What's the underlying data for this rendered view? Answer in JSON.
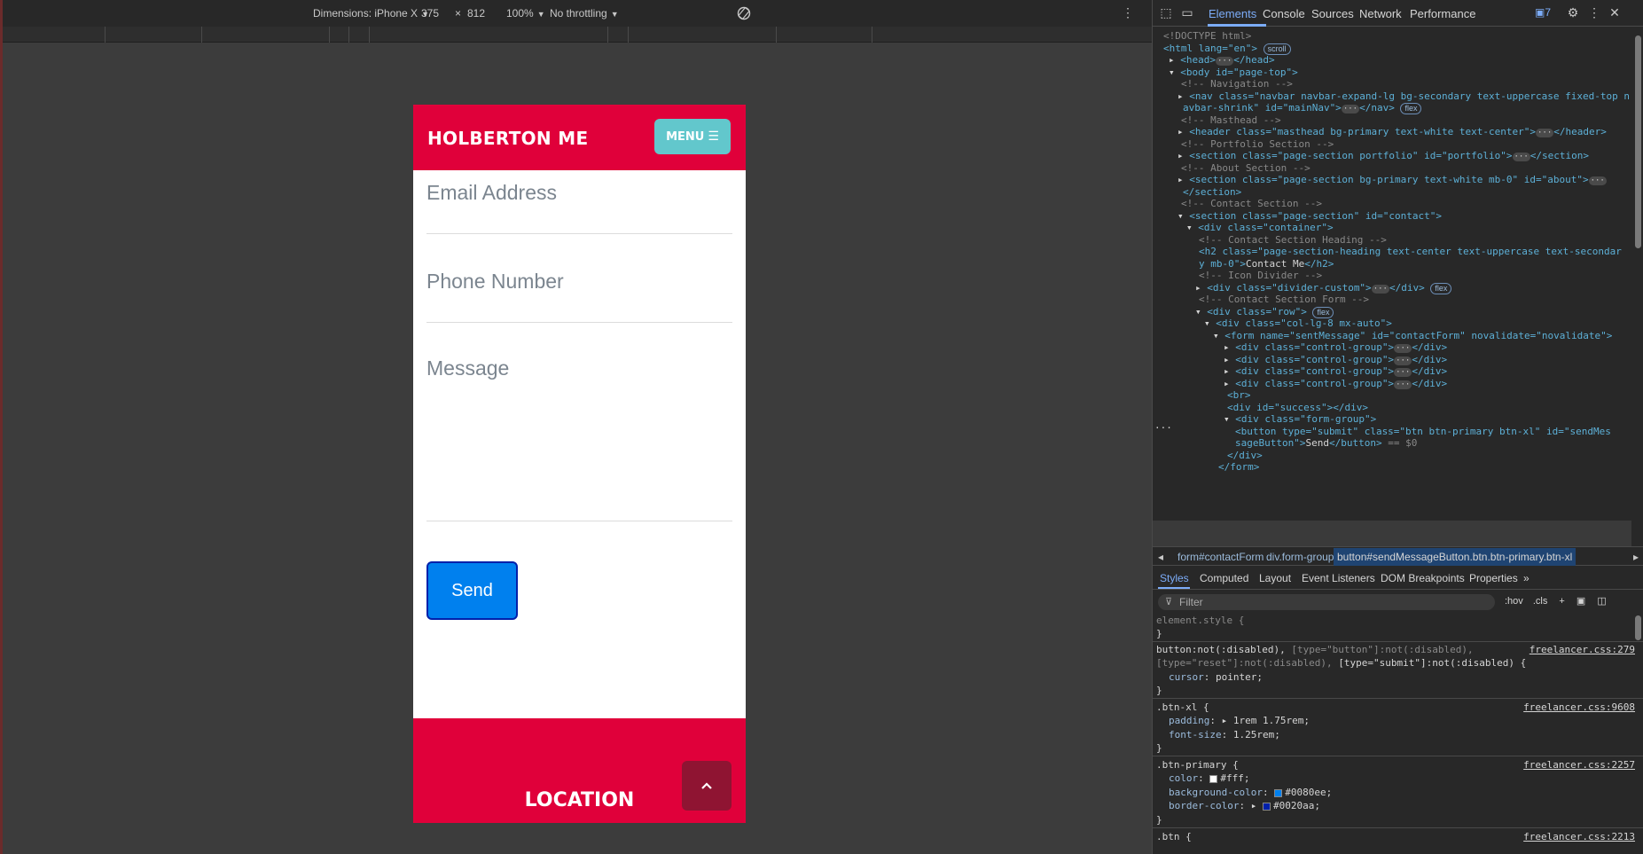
{
  "device_toolbar": {
    "dimensions_label": "Dimensions: iPhone X",
    "width": "375",
    "times": "×",
    "height": "812",
    "zoom": "100%",
    "throttling": "No throttling"
  },
  "page": {
    "brand": "HOLBERTON ME",
    "menu_label": "MENU",
    "email_placeholder": "Email Address",
    "phone_placeholder": "Phone Number",
    "message_placeholder": "Message",
    "send_label": "Send",
    "location_heading": "LOCATION"
  },
  "devtools": {
    "tabs": [
      "Elements",
      "Console",
      "Sources",
      "Network",
      "Performance"
    ],
    "issues_count": "7",
    "dom": {
      "doctype": "<!DOCTYPE html>",
      "html_open": "<html lang=\"en\">",
      "scroll_pill": "scroll",
      "head": "<head>",
      "head_close": "</head>",
      "body_open": "<body id=\"page-top\">",
      "c_nav": "<!-- Navigation -->",
      "nav_line1": "<nav class=\"navbar navbar-expand-lg bg-secondary text-uppercase fixed-top n",
      "nav_line2": "avbar-shrink\" id=\"mainNav\">",
      "nav_close": "</nav>",
      "flex_pill": "flex",
      "c_masthead": "<!-- Masthead -->",
      "header_line": "<header class=\"masthead bg-primary text-white text-center\">",
      "header_close": "</header>",
      "c_portfolio": "<!-- Portfolio Section -->",
      "portfolio_line": "<section class=\"page-section portfolio\" id=\"portfolio\">",
      "section_close": "</section>",
      "c_about": "<!-- About Section -->",
      "about_line": "<section class=\"page-section bg-primary text-white mb-0\" id=\"about\">",
      "about_close": "</section>",
      "c_contact": "<!-- Contact Section -->",
      "contact_line": "<section class=\"page-section\" id=\"contact\">",
      "container_line": "<div class=\"container\">",
      "c_heading": "<!-- Contact Section Heading -->",
      "h2_line1": "<h2 class=\"page-section-heading text-center text-uppercase text-secondar",
      "h2_line2": "y mb-0\">",
      "h2_text": "Contact Me",
      "h2_close": "</h2>",
      "c_divider": "<!-- Icon Divider -->",
      "divider_line": "<div class=\"divider-custom\">",
      "div_close": "</div>",
      "c_form": "<!-- Contact Section Form -->",
      "row_line": "<div class=\"row\">",
      "col_line": "<div class=\"col-lg-8 mx-auto\">",
      "form_line": "<form name=\"sentMessage\" id=\"contactForm\" novalidate=\"novalidate\">",
      "cg_line": "<div class=\"control-group\">",
      "br_line": "<br>",
      "success_line": "<div id=\"success\"></div>",
      "fg_line": "<div class=\"form-group\">",
      "button_line1": "<button type=\"submit\" class=\"btn btn-primary btn-xl\" id=\"sendMes",
      "button_line2": "sageButton\">",
      "button_text": "Send",
      "button_close": "</button>",
      "eq_dollar": "== $0",
      "fg_close": "</div>",
      "form_close": "</form>"
    },
    "breadcrumbs": [
      "form#contactForm",
      "div.form-group",
      "button#sendMessageButton.btn.btn-primary.btn-xl"
    ],
    "sub_tabs": [
      "Styles",
      "Computed",
      "Layout",
      "Event Listeners",
      "DOM Breakpoints",
      "Properties"
    ],
    "filter_placeholder": "Filter",
    "hov": ":hov",
    "cls": ".cls",
    "styles": {
      "element_style": "element.style {",
      "close_brace": "}",
      "r1_sel1": "button:not(:disabled),",
      "r1_sel2": "[type=\"button\"]:not(:disabled),",
      "r1_sel3": "[type=\"reset\"]:not(:disabled),",
      "r1_sel4": "[type=\"submit\"]:not(:disabled) {",
      "r1_src": "freelancer.css:279",
      "r1_prop": "cursor",
      "r1_val": "pointer;",
      "r2_sel": ".btn-xl {",
      "r2_src": "freelancer.css:9608",
      "r2_p1": "padding",
      "r2_v1": "1rem 1.75rem;",
      "r2_p2": "font-size",
      "r2_v2": "1.25rem;",
      "r3_sel": ".btn-primary {",
      "r3_src": "freelancer.css:2257",
      "r3_p1": "color",
      "r3_v1": "#fff;",
      "r3_p2": "background-color",
      "r3_v2": "#0080ee;",
      "r3_p3": "border-color",
      "r3_v3": "#0020aa;",
      "r4_sel": ".btn {",
      "r4_src": "freelancer.css:2213"
    }
  },
  "colors": {
    "primary_red": "#e0003a",
    "menu_teal": "#62c7cc",
    "send_blue": "#0080ee",
    "send_border": "#0020aa",
    "scroll_top": "#8f1432"
  }
}
